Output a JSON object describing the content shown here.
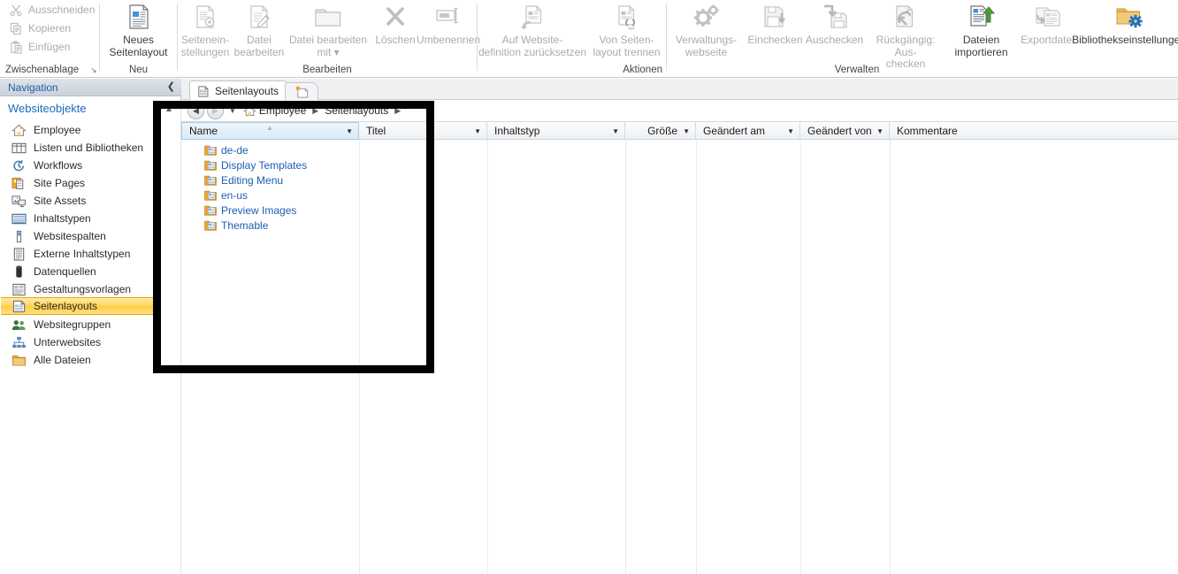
{
  "ribbon": {
    "groups": [
      {
        "label": "Zwischenablage",
        "launcher": "↘"
      },
      {
        "label": "Neu"
      },
      {
        "label": "Bearbeiten"
      },
      {
        "label": "Aktionen"
      },
      {
        "label": "Verwalten"
      }
    ],
    "clipboard": [
      {
        "label": "Ausschneiden",
        "icon": "scissors-icon",
        "enabled": false
      },
      {
        "label": "Kopieren",
        "icon": "copy-icon",
        "enabled": false
      },
      {
        "label": "Einfügen",
        "icon": "paste-icon",
        "enabled": false
      }
    ],
    "buttons": [
      {
        "label": "Neues\nSeitenlayout",
        "icon": "new-page-layout-icon",
        "enabled": true
      },
      {
        "label": "Seitenein-\nstellungen",
        "icon": "page-settings-icon",
        "enabled": false
      },
      {
        "label": "Datei\nbearbeiten",
        "icon": "edit-file-icon",
        "enabled": false
      },
      {
        "label": "Datei bearbeiten\nmit ▾",
        "icon": "edit-file-with-icon",
        "enabled": false
      },
      {
        "label": "Löschen",
        "icon": "delete-icon",
        "enabled": false
      },
      {
        "label": "Umbenennen",
        "icon": "rename-icon",
        "enabled": false
      },
      {
        "label": "Auf Website-\ndefinition zurücksetzen",
        "icon": "reset-to-site-definition-icon",
        "enabled": false
      },
      {
        "label": "Von Seiten-\nlayout trennen",
        "icon": "detach-from-page-layout-icon",
        "enabled": false
      },
      {
        "label": "Verwaltungs-\nwebseite",
        "icon": "administration-web-page-icon",
        "enabled": false
      },
      {
        "label": "Einchecken",
        "icon": "check-in-icon",
        "enabled": false
      },
      {
        "label": "Auschecken",
        "icon": "check-out-icon",
        "enabled": false
      },
      {
        "label": "Rückgängig: Aus-\nchecken",
        "icon": "undo-check-out-icon",
        "enabled": false
      },
      {
        "label": "Dateien\nimportieren",
        "icon": "import-files-icon",
        "enabled": true
      },
      {
        "label": "Exportdatei",
        "icon": "export-file-icon",
        "enabled": false
      },
      {
        "label": "Bibliothekseinstellungen",
        "icon": "library-settings-icon",
        "enabled": true
      }
    ]
  },
  "nav": {
    "title": "Navigation",
    "collapse_icon": "chevron-left-icon",
    "section": "Websiteobjekte",
    "items": [
      {
        "label": "Employee",
        "icon": "home-icon",
        "selected": false
      },
      {
        "label": "Listen und Bibliotheken",
        "icon": "lists-libraries-icon",
        "selected": false
      },
      {
        "label": "Workflows",
        "icon": "workflows-icon",
        "selected": false
      },
      {
        "label": "Site Pages",
        "icon": "site-pages-icon",
        "selected": false
      },
      {
        "label": "Site Assets",
        "icon": "site-assets-icon",
        "selected": false
      },
      {
        "label": "Inhaltstypen",
        "icon": "content-types-icon",
        "selected": false
      },
      {
        "label": "Websitespalten",
        "icon": "site-columns-icon",
        "selected": false
      },
      {
        "label": "Externe Inhaltstypen",
        "icon": "external-content-types-icon",
        "selected": false
      },
      {
        "label": "Datenquellen",
        "icon": "data-sources-icon",
        "selected": false
      },
      {
        "label": "Gestaltungsvorlagen",
        "icon": "master-pages-icon",
        "selected": false
      },
      {
        "label": "Seitenlayouts",
        "icon": "page-layouts-icon",
        "selected": true
      },
      {
        "label": "Websitegruppen",
        "icon": "site-groups-icon",
        "selected": false
      },
      {
        "label": "Unterwebsites",
        "icon": "subsites-icon",
        "selected": false
      },
      {
        "label": "Alle Dateien",
        "icon": "all-files-icon",
        "selected": false
      }
    ]
  },
  "tabs": {
    "active": {
      "label": "Seitenlayouts",
      "icon": "page-layout-tab-icon"
    },
    "new_tab_icon": "new-tab-icon"
  },
  "breadcrumb": {
    "back_icon": "back-arrow-icon",
    "forward_icon": "forward-arrow-icon",
    "dropdown_icon": "history-dropdown-icon",
    "home_icon": "home-icon",
    "items": [
      "Employee",
      "Seitenlayouts"
    ],
    "separator": "▶"
  },
  "list": {
    "columns": [
      {
        "label": "Name",
        "sorted": true,
        "filter": true,
        "align": "left"
      },
      {
        "label": "Titel",
        "sorted": false,
        "filter": true,
        "align": "left"
      },
      {
        "label": "Inhaltstyp",
        "sorted": false,
        "filter": true,
        "align": "left"
      },
      {
        "label": "Größe",
        "sorted": false,
        "filter": true,
        "align": "right"
      },
      {
        "label": "Geändert am",
        "sorted": false,
        "filter": true,
        "align": "left"
      },
      {
        "label": "Geändert von",
        "sorted": false,
        "filter": true,
        "align": "left"
      },
      {
        "label": "Kommentare",
        "sorted": false,
        "filter": false,
        "align": "left"
      }
    ],
    "rows": [
      {
        "name": "de-de",
        "icon": "folder-icon"
      },
      {
        "name": "Display Templates",
        "icon": "folder-icon"
      },
      {
        "name": "Editing Menu",
        "icon": "folder-icon"
      },
      {
        "name": "en-us",
        "icon": "folder-icon"
      },
      {
        "name": "Preview Images",
        "icon": "folder-icon"
      },
      {
        "name": "Themable",
        "icon": "folder-icon"
      }
    ]
  },
  "annotation": {
    "shape": "rectangle",
    "color": "#000000"
  },
  "colors": {
    "accent_blue": "#1b5fad",
    "selection_gold": "#ffcf3e",
    "folder_orange": "#f0a830",
    "disabled_gray": "#a9abad"
  }
}
